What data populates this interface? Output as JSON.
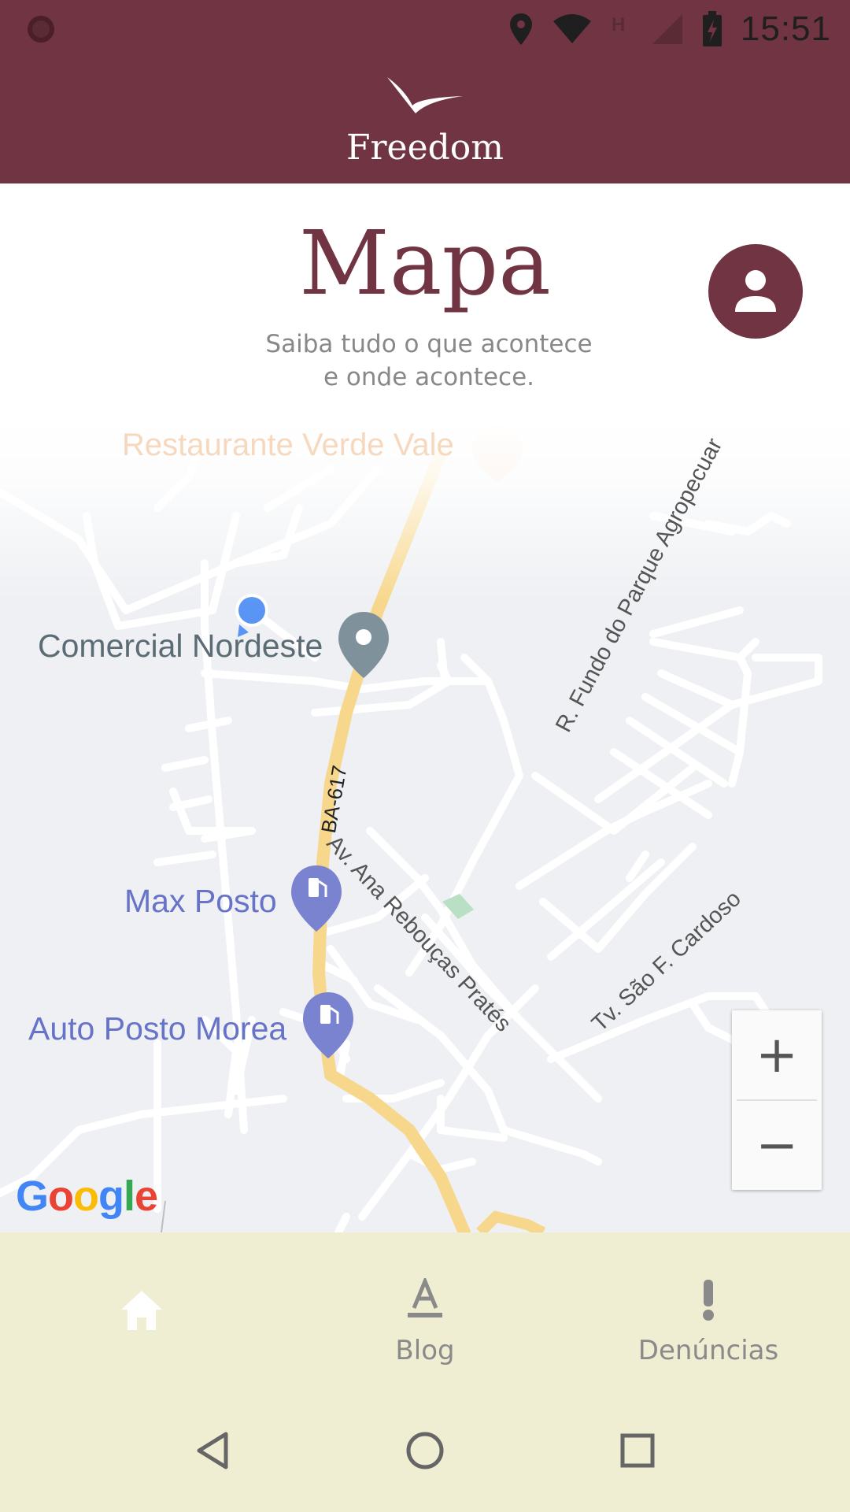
{
  "status_bar": {
    "time": "15:51",
    "icons": [
      "settings-icon",
      "location-icon",
      "wifi-icon",
      "h-signal-icon",
      "cell-signal-icon",
      "battery-charging-icon"
    ]
  },
  "header": {
    "app_name": "Freedom",
    "logo": "bird-icon"
  },
  "page": {
    "title": "Mapa",
    "subtitle_line1": "Saiba tudo o que acontece",
    "subtitle_line2": "e onde acontece.",
    "profile_icon": "person-icon"
  },
  "map": {
    "places": {
      "restaurant": "Restaurante Verde Vale",
      "comercial": "Comercial Nordeste",
      "max_posto": "Max Posto",
      "auto_posto": "Auto Posto Morea"
    },
    "roads": {
      "ba": "BA-617",
      "fundo": "R. Fundo do Parque Agropecuar",
      "ana": "Av. Ana Rebouças Pratés",
      "sao": "Tv. São F. Cardoso"
    },
    "zoom_in": "+",
    "zoom_out": "−",
    "attribution": "Google",
    "colors": {
      "highway": "#f7d78b",
      "road": "#ffffff",
      "background": "#eef0f3",
      "fuel_pin": "#7a83cf",
      "place_pin": "#7f929c",
      "user_dot": "#5a95f5"
    }
  },
  "bottom_nav": {
    "items": [
      {
        "label": "",
        "icon": "home-icon"
      },
      {
        "label": "Blog",
        "icon": "text-a-icon"
      },
      {
        "label": "Denúncias",
        "icon": "exclamation-icon"
      }
    ]
  },
  "system_nav": {
    "icons": [
      "back-icon",
      "home-circle-icon",
      "recents-icon"
    ]
  }
}
